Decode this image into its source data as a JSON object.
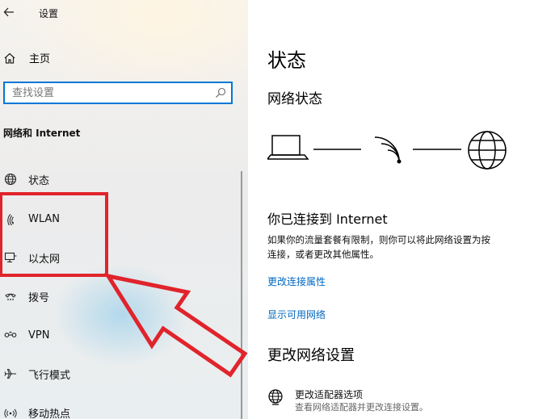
{
  "window": {
    "title": "设置"
  },
  "sidebar": {
    "home_label": "主页",
    "search": {
      "placeholder": "查找设置"
    },
    "section_title": "网络和 Internet",
    "items": [
      {
        "label": "状态",
        "icon": "globe-icon"
      },
      {
        "label": "WLAN",
        "icon": "wifi-icon"
      },
      {
        "label": "以太网",
        "icon": "ethernet-icon"
      },
      {
        "label": "拨号",
        "icon": "dialup-icon"
      },
      {
        "label": "VPN",
        "icon": "vpn-icon"
      },
      {
        "label": "飞行模式",
        "icon": "airplane-icon"
      },
      {
        "label": "移动热点",
        "icon": "hotspot-icon"
      }
    ]
  },
  "main": {
    "title": "状态",
    "network_status_heading": "网络状态",
    "connected_heading": "你已连接到 Internet",
    "description_line1": "如果你的流量套餐有限制，则你可以将此网络设置为按",
    "description_line2": "连接，或者更改其他属性。",
    "link_change_properties": "更改连接属性",
    "link_show_networks": "显示可用网络",
    "change_settings_heading": "更改网络设置",
    "adapter_title": "更改适配器选项",
    "adapter_desc": "查看网络适配器并更改连接设置。"
  },
  "colors": {
    "accent": "#0078d7",
    "link": "#0067c0",
    "annotation_red": "#e0242b"
  }
}
